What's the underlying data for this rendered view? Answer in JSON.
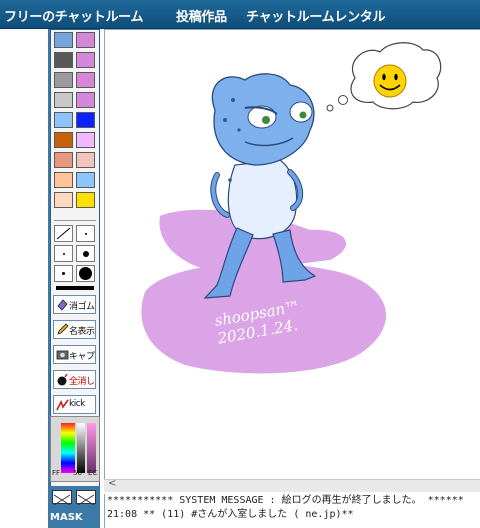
{
  "topnav": {
    "links": [
      {
        "label": "フリーのチャットルーム"
      },
      {
        "label": "投稿作品"
      },
      {
        "label": "チャットルームレンタル"
      }
    ]
  },
  "colors": {
    "swatches": [
      [
        "#75a3dc",
        "#d487d8"
      ],
      [
        "#585858",
        "#d487d8"
      ],
      [
        "#9b9b9b",
        "#d487d8"
      ],
      [
        "#c8c8c8",
        "#d487d8"
      ],
      [
        "#8cc4ff",
        "#0a23ff"
      ],
      [
        "#c8620a",
        "#f0b9ff"
      ],
      [
        "#e8987a",
        "#f0c2c0"
      ],
      [
        "#ffc49a",
        "#8cc4ff"
      ],
      [
        "#ffd8c0",
        "#ffe000"
      ]
    ]
  },
  "tools": {
    "buttons": [
      {
        "label": "消ゴム",
        "icon": "eraser-icon"
      },
      {
        "label": "名表示",
        "icon": "pen-name-icon"
      },
      {
        "label": "キャプ",
        "icon": "camera-icon"
      },
      {
        "label": "全消し",
        "icon": "bomb-icon"
      },
      {
        "label": "kick",
        "icon": "kick-icon"
      }
    ],
    "palette_labels": [
      "FF",
      "56",
      "EC"
    ],
    "mask_label": "MASK"
  },
  "canvas": {
    "signature": "shoopsan™ 2020.1.24."
  },
  "log": {
    "lines": [
      "*********** SYSTEM MESSAGE : 絵ログの再生が終了しました。 ******",
      "21:08 ** (11) #さんが入室しました (           ne.jp)**"
    ]
  }
}
